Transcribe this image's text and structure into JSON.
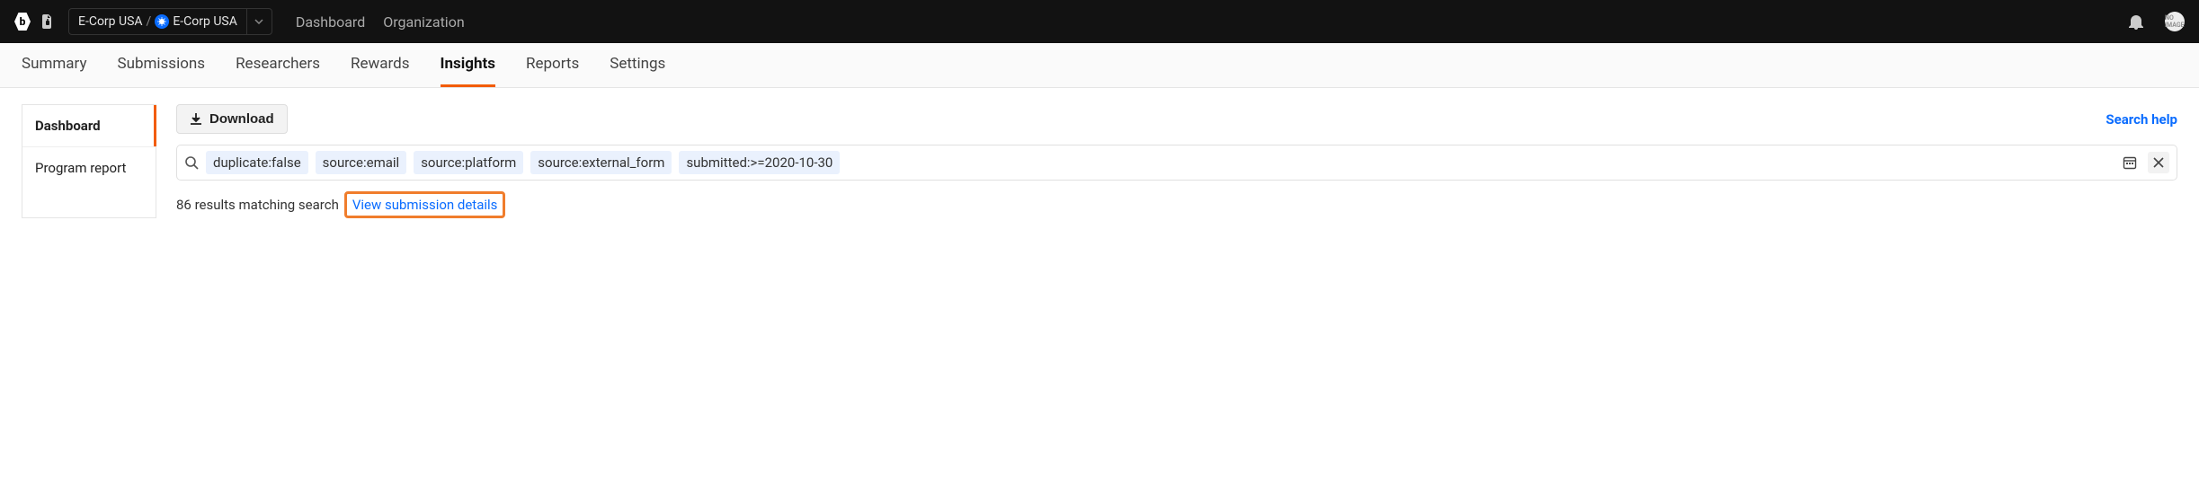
{
  "header": {
    "org_parent": "E-Corp USA",
    "org_current": "E-Corp USA",
    "nav": {
      "dashboard": "Dashboard",
      "organization": "Organization"
    }
  },
  "tabs": {
    "summary": "Summary",
    "submissions": "Submissions",
    "researchers": "Researchers",
    "rewards": "Rewards",
    "insights": "Insights",
    "reports": "Reports",
    "settings": "Settings"
  },
  "sidebar": {
    "items": [
      {
        "label": "Dashboard",
        "active": true
      },
      {
        "label": "Program report",
        "active": false
      }
    ]
  },
  "toolbar": {
    "download_label": "Download",
    "search_help": "Search help"
  },
  "search": {
    "chips": [
      "duplicate:false",
      "source:email",
      "source:platform",
      "source:external_form",
      "submitted:>=2020-10-30"
    ]
  },
  "results": {
    "count_text": "86 results matching search",
    "view_details": "View submission details"
  },
  "avatar_text": "NO IMAGE"
}
